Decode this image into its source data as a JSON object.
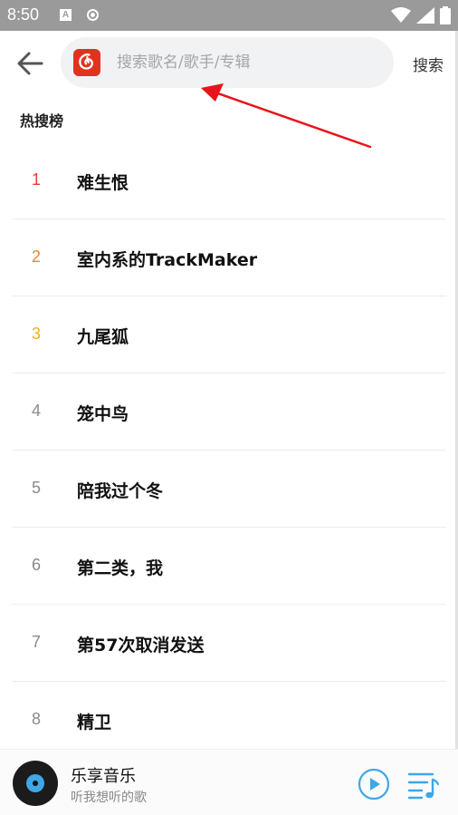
{
  "status_bar": {
    "time": "8:50",
    "a_icon_letter": "A"
  },
  "top_bar": {
    "search_placeholder": "搜索歌名/歌手/专辑",
    "search_button": "搜索"
  },
  "hot_search": {
    "title": "热搜榜",
    "items": [
      {
        "rank": "1",
        "name": "难生恨",
        "rank_color": "#e63b3b"
      },
      {
        "rank": "2",
        "name": "室内系的TrackMaker",
        "rank_color": "#f0862c"
      },
      {
        "rank": "3",
        "name": "九尾狐",
        "rank_color": "#f3b01e"
      },
      {
        "rank": "4",
        "name": "笼中鸟",
        "rank_color": "#8a8a8a"
      },
      {
        "rank": "5",
        "name": "陪我过个冬",
        "rank_color": "#8a8a8a"
      },
      {
        "rank": "6",
        "name": "第二类，我",
        "rank_color": "#8a8a8a"
      },
      {
        "rank": "7",
        "name": "第57次取消发送",
        "rank_color": "#8a8a8a"
      },
      {
        "rank": "8",
        "name": "精卫",
        "rank_color": "#8a8a8a"
      }
    ]
  },
  "player": {
    "title": "乐享音乐",
    "subtitle": "听我想听的歌"
  },
  "colors": {
    "accent_blue": "#3ea7e8",
    "logo_red": "#e0331f",
    "annotation_red": "#e8141b"
  }
}
